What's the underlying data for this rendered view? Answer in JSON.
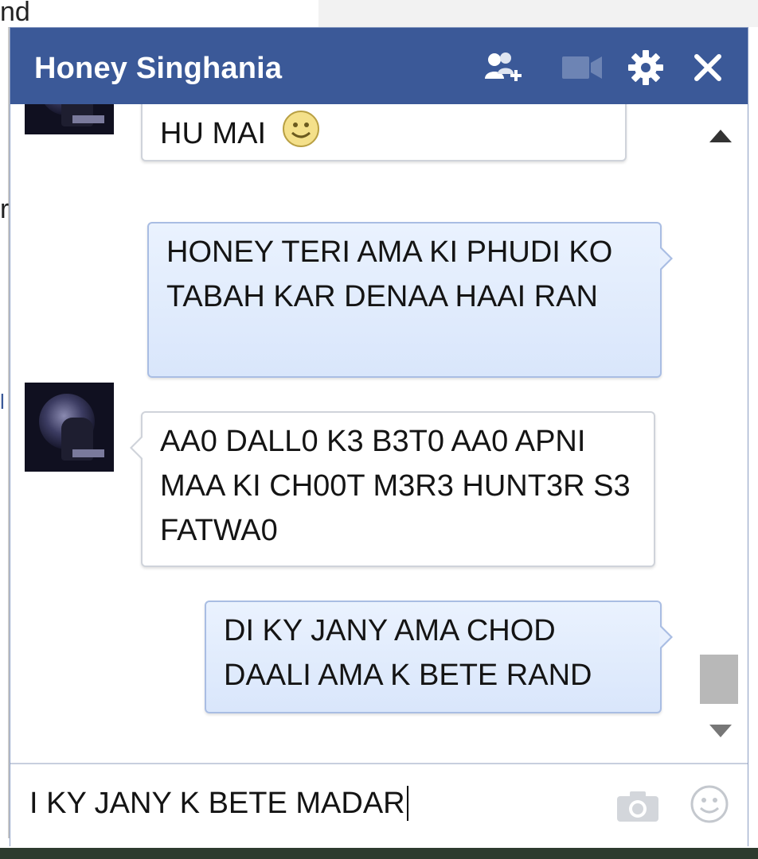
{
  "background": {
    "fragments": [
      "nd",
      "r",
      "l"
    ]
  },
  "chat": {
    "title": "Honey Singhania",
    "header_icons": [
      "add-friends-icon",
      "video-call-icon",
      "gear-icon",
      "close-icon"
    ],
    "messages": [
      {
        "direction": "in",
        "text": "HU MAI",
        "emoji": "smiley"
      },
      {
        "direction": "out",
        "text": "HONEY TERI AMA KI PHUDI KO TABAH KAR DENAA HAAI RAN"
      },
      {
        "direction": "in",
        "text": "AA0 DALL0 K3 B3T0 AA0 APNI MAA KI CH00T M3R3 HUNT3R S3 FATWA0"
      },
      {
        "direction": "out",
        "text": "DI KY JANY AMA CHOD DAALI AMA K BETE RAND"
      }
    ],
    "composer": {
      "value": "I KY JANY K BETE MADAR"
    }
  },
  "colors": {
    "header": "#3b5998",
    "outgoing_bubble": "#dde8fb",
    "incoming_bubble": "#ffffff"
  }
}
